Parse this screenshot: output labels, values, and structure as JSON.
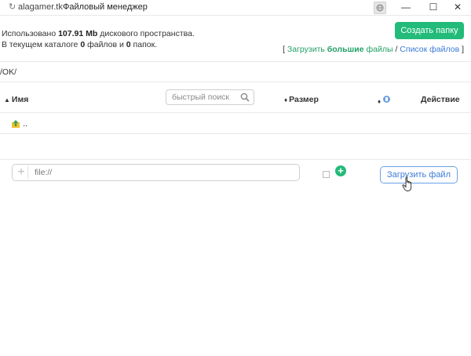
{
  "titlebar": {
    "domain": "alagamer.tk",
    "title": "Файловый менеджер",
    "minimize": "—",
    "maximize": "☐",
    "close": "✕"
  },
  "usage": {
    "prefix": "Использовано ",
    "amount": "107.91 Mb",
    "suffix": " дискового пространства.",
    "line2_prefix": "В текущем каталоге ",
    "files": "0",
    "mid": " файлов и ",
    "folders": "0",
    "line2_suffix": " папок."
  },
  "create_button": "Создать папку",
  "links": {
    "open": "[ ",
    "upload_large_1": "Загрузить ",
    "upload_large_bold": "большие",
    "upload_large_2": " файлы",
    "slash": " / ",
    "file_list": "Список файлов",
    "close": " ]"
  },
  "path": "/OK/",
  "table": {
    "col_name": "Имя",
    "col_size": "Размер",
    "col_action": "Действие",
    "search_placeholder": "быстрый поиск",
    "parent_dir": ".."
  },
  "upload": {
    "placeholder": "file://",
    "button": "Загрузить файл"
  },
  "colors": {
    "accent_green": "#22bb7a",
    "link_blue": "#3b7bd6"
  }
}
